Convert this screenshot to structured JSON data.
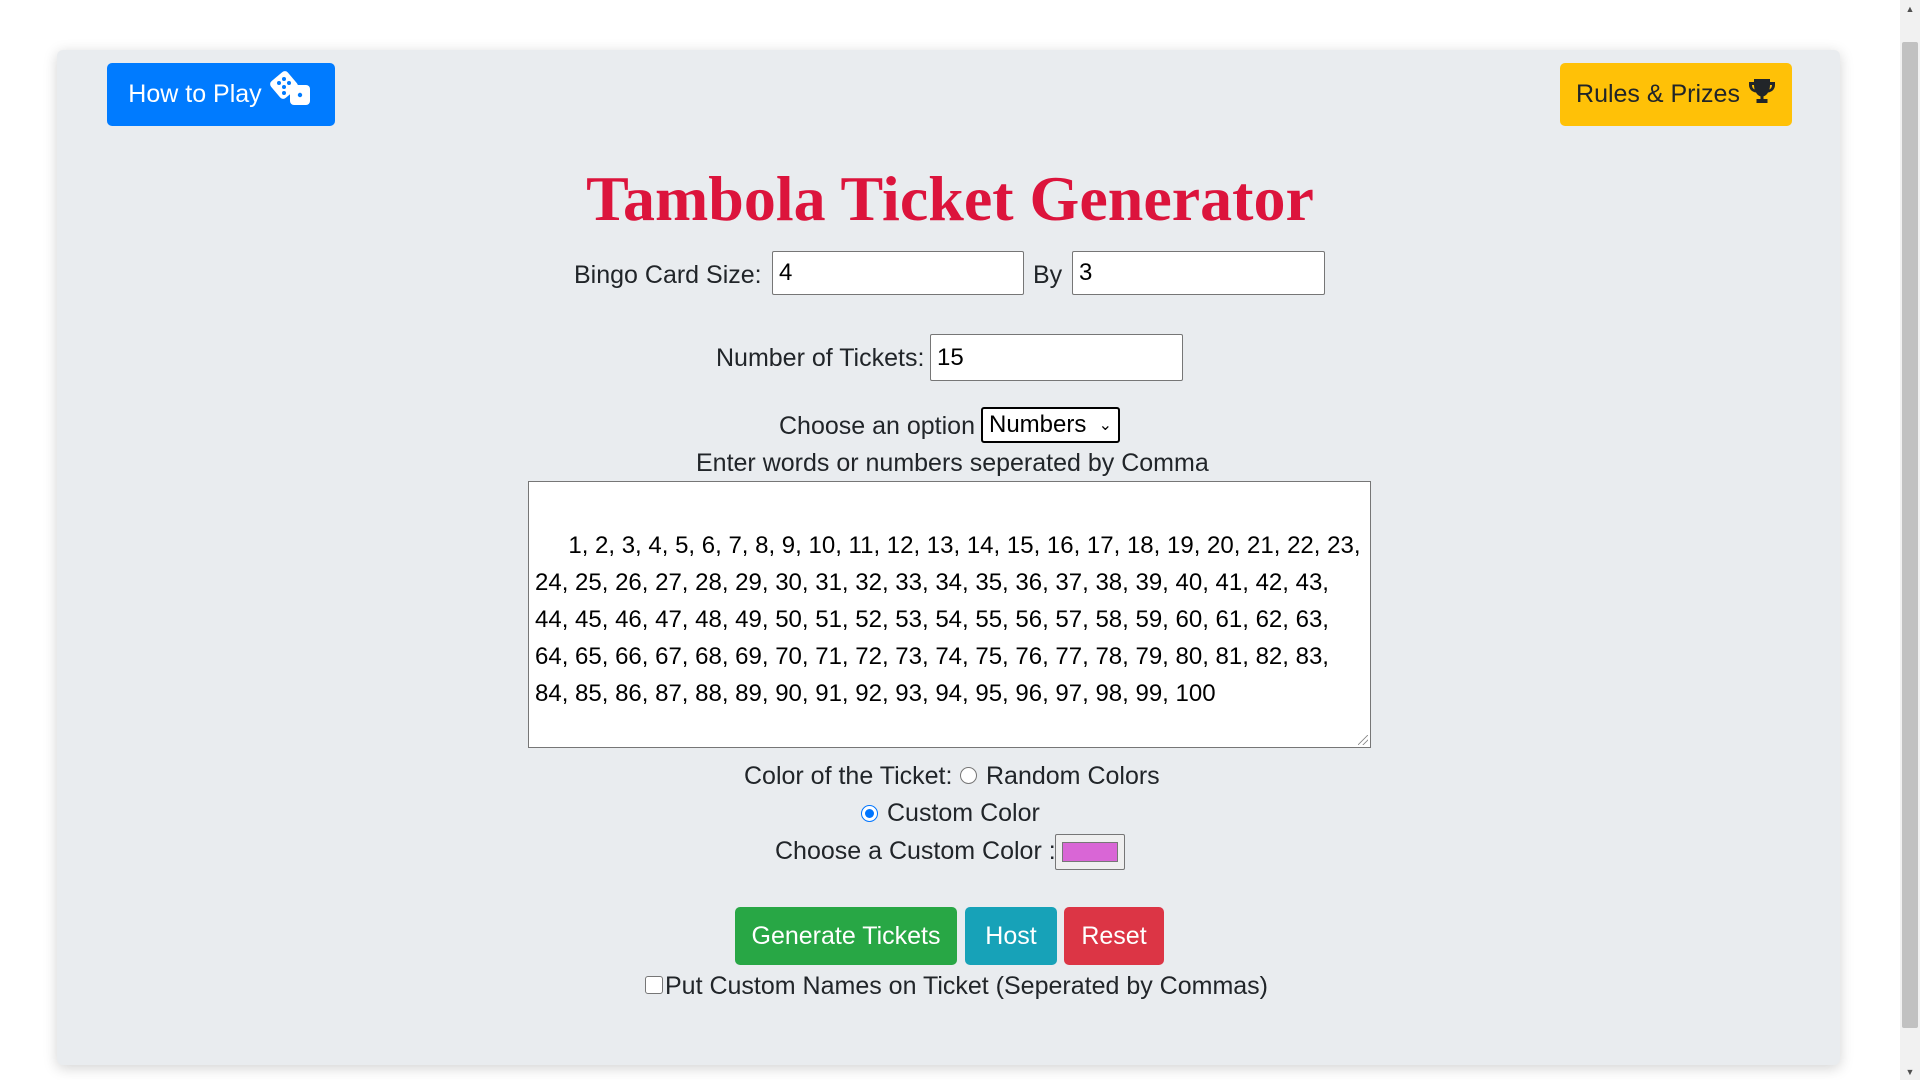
{
  "header": {
    "how_to_play_label": "How to Play",
    "how_to_play_icon": "dice-icon",
    "rules_label": "Rules & Prizes",
    "rules_icon": "trophy-icon"
  },
  "title": "Tambola Ticket Generator",
  "card_size": {
    "label": "Bingo Card Size:",
    "rows_value": "4",
    "by_label": "By",
    "cols_value": "3"
  },
  "tickets": {
    "label": "Number of Tickets:",
    "value": "15"
  },
  "option": {
    "label": "Choose an option",
    "selected": "Numbers"
  },
  "entries": {
    "label": "Enter words or numbers seperated by Comma",
    "value": " 1, 2, 3, 4, 5, 6, 7, 8, 9, 10, 11, 12, 13, 14, 15, 16, 17, 18, 19, 20, 21, 22, 23, 24, 25, 26, 27, 28, 29, 30, 31, 32, 33, 34, 35, 36, 37, 38, 39, 40, 41, 42, 43, 44, 45, 46, 47, 48, 49, 50, 51, 52, 53, 54, 55, 56, 57, 58, 59, 60, 61, 62, 63, 64, 65, 66, 67, 68, 69, 70, 71, 72, 73, 74, 75, 76, 77, 78, 79, 80, 81, 82, 83, 84, 85, 86, 87, 88, 89, 90, 91, 92, 93, 94, 95, 96, 97, 98, 99, 100"
  },
  "color": {
    "label": "Color of the Ticket:",
    "random_label": "Random Colors",
    "custom_label": "Custom Color",
    "selected": "custom",
    "picker_label": "Choose a Custom Color :",
    "custom_value": "#d966d6"
  },
  "actions": {
    "generate_label": "Generate Tickets",
    "host_label": "Host",
    "reset_label": "Reset"
  },
  "custom_names": {
    "label": "Put Custom Names on Ticket (Seperated by Commas)",
    "checked": false
  },
  "colors": {
    "primary": "#007bff",
    "warning": "#ffc107",
    "success": "#28a745",
    "info": "#17a2b8",
    "danger": "#dc3545",
    "title": "#dc143c"
  }
}
